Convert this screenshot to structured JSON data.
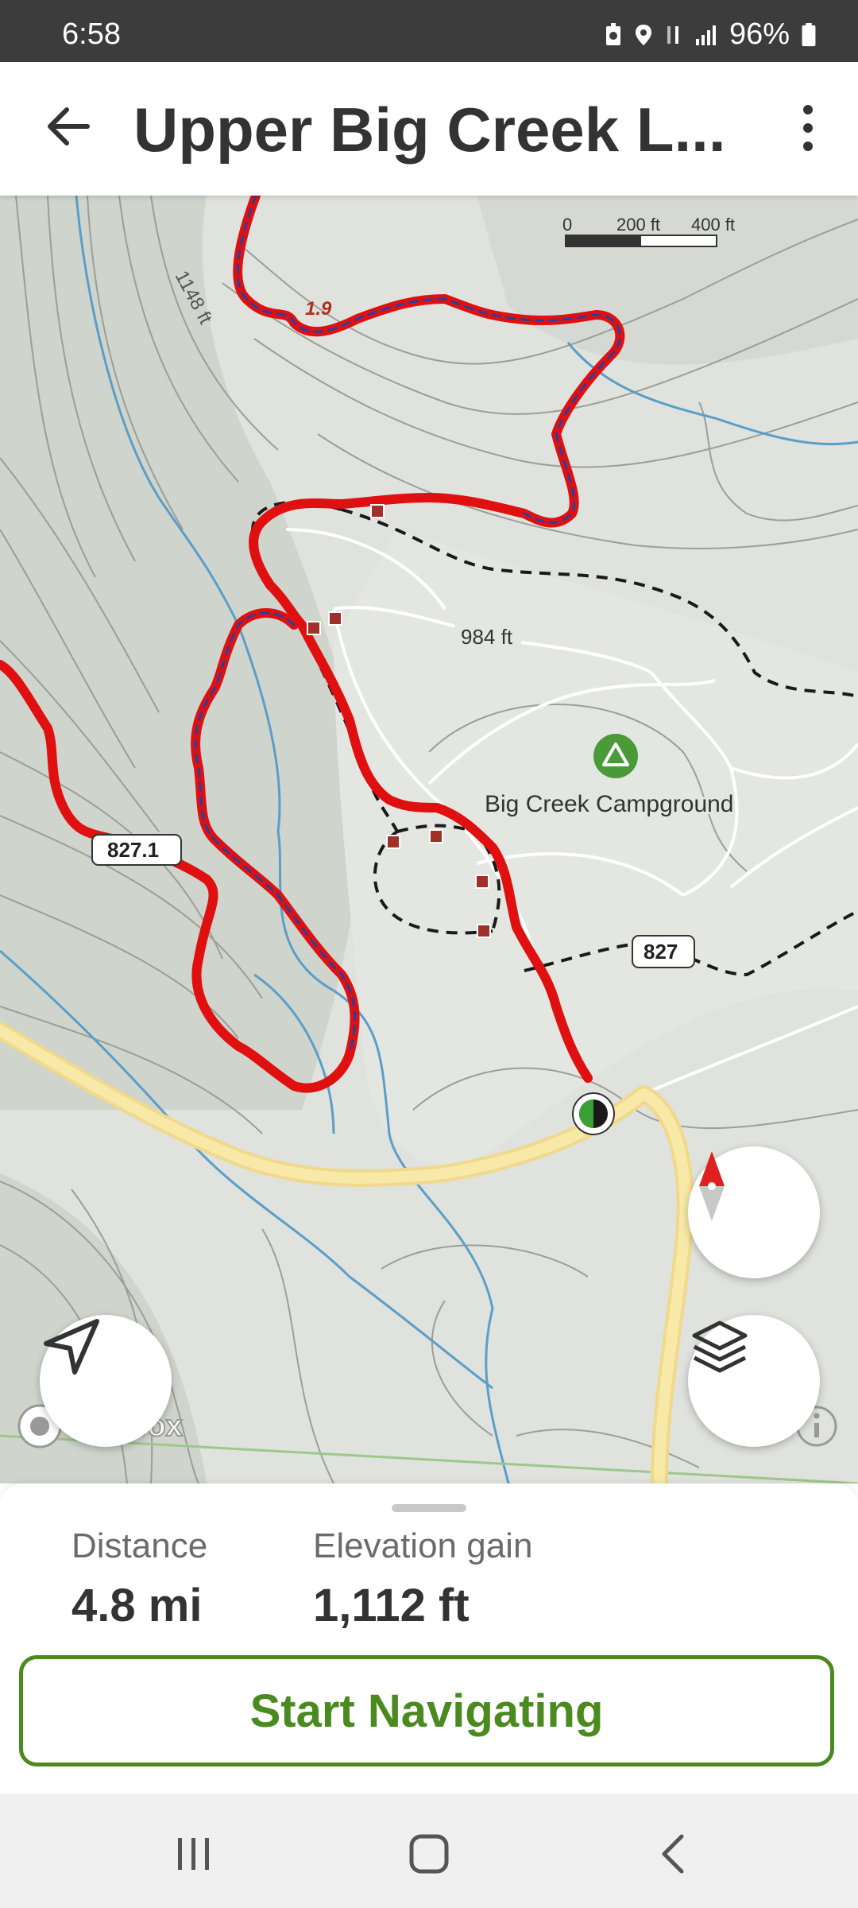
{
  "status_bar": {
    "time": "6:58",
    "battery": "96%"
  },
  "header": {
    "title": "Upper Big Creek L..."
  },
  "map": {
    "scale": {
      "zero": "0",
      "mid": "200 ft",
      "max": "400 ft"
    },
    "labels": {
      "contour_1148": "1148 ft",
      "contour_984": "984 ft",
      "mile_marker": "1.9",
      "campground": "Big Creek Campground",
      "junction_1": "827.1",
      "junction_2": "827"
    },
    "attribution": "mapbox"
  },
  "stats": {
    "distance": {
      "label": "Distance",
      "value": "4.8 mi"
    },
    "elevation": {
      "label": "Elevation gain",
      "value": "1,112 ft"
    }
  },
  "actions": {
    "start_navigating": "Start Navigating"
  },
  "colors": {
    "trail": "#e01010",
    "brand_green": "#4a8a1f",
    "road": "#f5e08a",
    "stream": "#5a9ec9"
  }
}
